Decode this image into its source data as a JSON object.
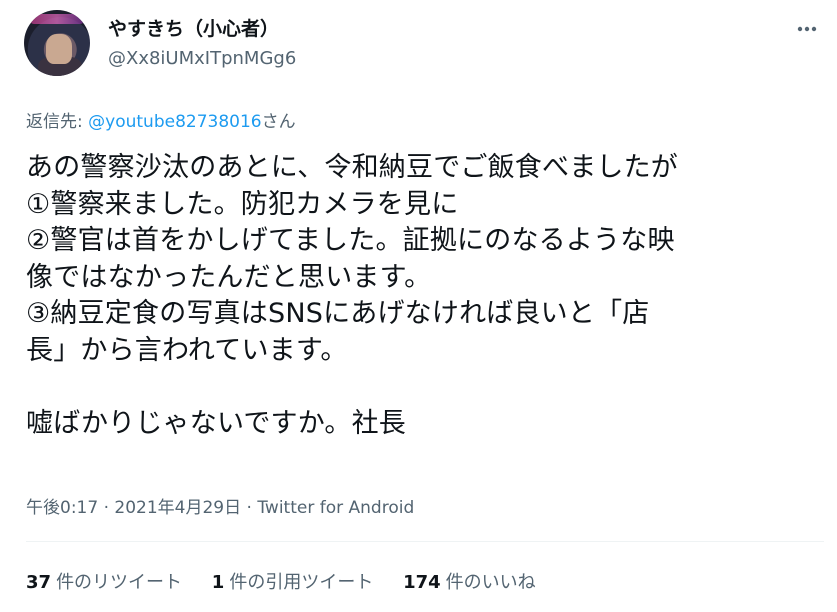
{
  "author": {
    "display_name": "やすきち（小心者）",
    "handle": "@Xx8iUMxITpnMGg6"
  },
  "reply": {
    "prefix": "返信先: ",
    "mention": "@youtube82738016",
    "suffix": "さん"
  },
  "tweet": {
    "lines": [
      "あの警察沙汰のあとに、令和納豆でご飯食べましたが",
      "①警察来ました。防犯カメラを見に",
      "②警官は首をかしげてました。証拠にのなるような映",
      "像ではなかったんだと思います。",
      "③納豆定食の写真はSNSにあげなければ良いと「店",
      "長」から言われています。",
      "",
      "嘘ばかりじゃないですか。社長"
    ]
  },
  "meta": {
    "time": "午後0:17",
    "separator": " · ",
    "date": "2021年4月29日",
    "source": "Twitter for Android"
  },
  "stats": {
    "retweets_count": "37",
    "retweets_label": "件のリツイート",
    "quotes_count": "1",
    "quotes_label": "件の引用ツイート",
    "likes_count": "174",
    "likes_label": "件のいいね"
  },
  "icons": {
    "more": "more-horizontal-icon"
  },
  "colors": {
    "text": "#0f1419",
    "secondary": "#536471",
    "link": "#1d9bf0",
    "divider": "#eff3f4"
  }
}
